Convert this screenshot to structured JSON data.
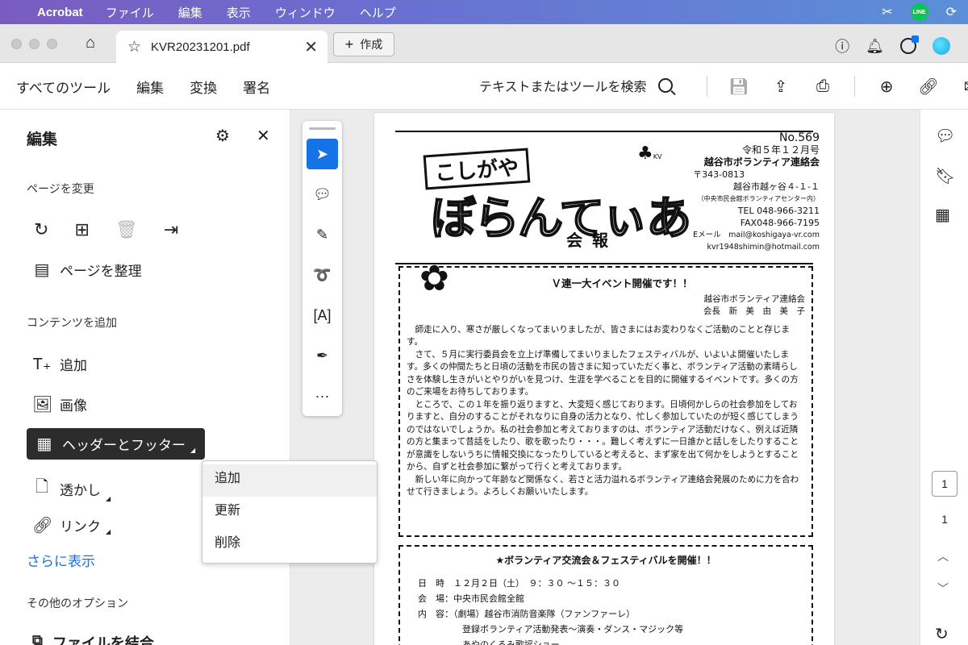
{
  "menubar": {
    "app": "Acrobat",
    "items": [
      "ファイル",
      "編集",
      "表示",
      "ウィンドウ",
      "ヘルプ"
    ],
    "line_label": "LINE"
  },
  "tabbar": {
    "tab_title": "KVR20231201.pdf",
    "create_label": "作成"
  },
  "toolbar": {
    "nav": [
      "すべてのツール",
      "編集",
      "変換",
      "署名"
    ],
    "search_placeholder": "テキストまたはツールを検索"
  },
  "left_panel": {
    "title": "編集",
    "section_pages": "ページを変更",
    "organize_label": "ページを整理",
    "section_content": "コンテンツを追加",
    "items": {
      "add_text": "追加",
      "image": "画像",
      "header_footer": "ヘッダーとフッター",
      "watermark": "透かし",
      "link": "リンク"
    },
    "more_label": "さらに表示",
    "section_other": "その他のオプション",
    "combine_label": "ファイルを結合"
  },
  "popup_menu": {
    "items": [
      "追加",
      "更新",
      "削除"
    ]
  },
  "document": {
    "masthead": {
      "logo_top": "こしがや",
      "logo_main": "ぼらんてぃあ",
      "subtitle": "会報",
      "clover_label": "KV",
      "number": "No.569",
      "date": "令和５年１２月号",
      "org": "越谷市ボランティア連絡会",
      "postal": "〒343-0813",
      "address": "越谷市越ヶ谷４-１-１",
      "address_note": "（中央市民会館ボランティアセンター内）",
      "tel": "TEL 048-966-3211",
      "fax": "FAX048-966-7195",
      "email": "Eメール　mail@koshigaya-vr.com",
      "email2": "kvr1948shimin@hotmail.com"
    },
    "article1": {
      "title": "Ｖ連一大イベント開催です！！",
      "sig_org": "越谷市ボランティア連絡会",
      "sig_name": "会長　新　美　由　美　子",
      "paragraphs": [
        "師走に入り、寒さが厳しくなってまいりましたが、皆さまにはお変わりなくご活動のことと存じます。",
        "さて、５月に実行委員会を立上げ準備してまいりましたフェスティバルが、いよいよ開催いたします。多くの仲間たちと日頃の活動を市民の皆さまに知っていただく事と、ボランティア活動の素晴らしさを体験し生きがいとやりがいを見つけ、生涯を学べることを目的に開催するイベントです。多くの方のご来場をお待ちしております。",
        "ところで、この１年を振り返りますと、大変短く感じております。日頃何かしらの社会参加をしておりますと、自分のすることがそれなりに自身の活力となり、忙しく参加していたのが短く感じてしまうのではないでしょうか。私の社会参加と考えておりますのは、ボランティア活動だけなく、例えば近隣の方と集まって昔話をしたり、歌を歌ったり・・・。難しく考えずに一日誰かと話しをしたりすることが意識をしないうちに情報交換になったりしていると考えると、まず家を出て何かをしようとすることから、自ずと社会参加に繋がって行くと考えております。",
        "新しい年に向かって年齢など関係なく、若さと活力溢れるボランティア連絡会発展のために力を合わせて行きましょう。よろしくお願いいたします。"
      ]
    },
    "article2": {
      "title": "★ボランティア交流会＆フェスティバルを開催！！",
      "rows": [
        "日　時　１２月２日（土）　９：３０ ～１５：３０",
        "会　場：中央市民会館全館",
        "内　容：（劇場）越谷市消防音楽隊（ファンファーレ）",
        "　　　　　登録ボランティア活動発表～演奏・ダンス・マジック等",
        "　　　　　あやのくるみ歌謡ショー"
      ]
    }
  },
  "right_rail": {
    "current_page": "1",
    "total_pages": "1"
  },
  "colors": {
    "accent": "#1473e6",
    "selected_item": "#2c2c2c"
  }
}
